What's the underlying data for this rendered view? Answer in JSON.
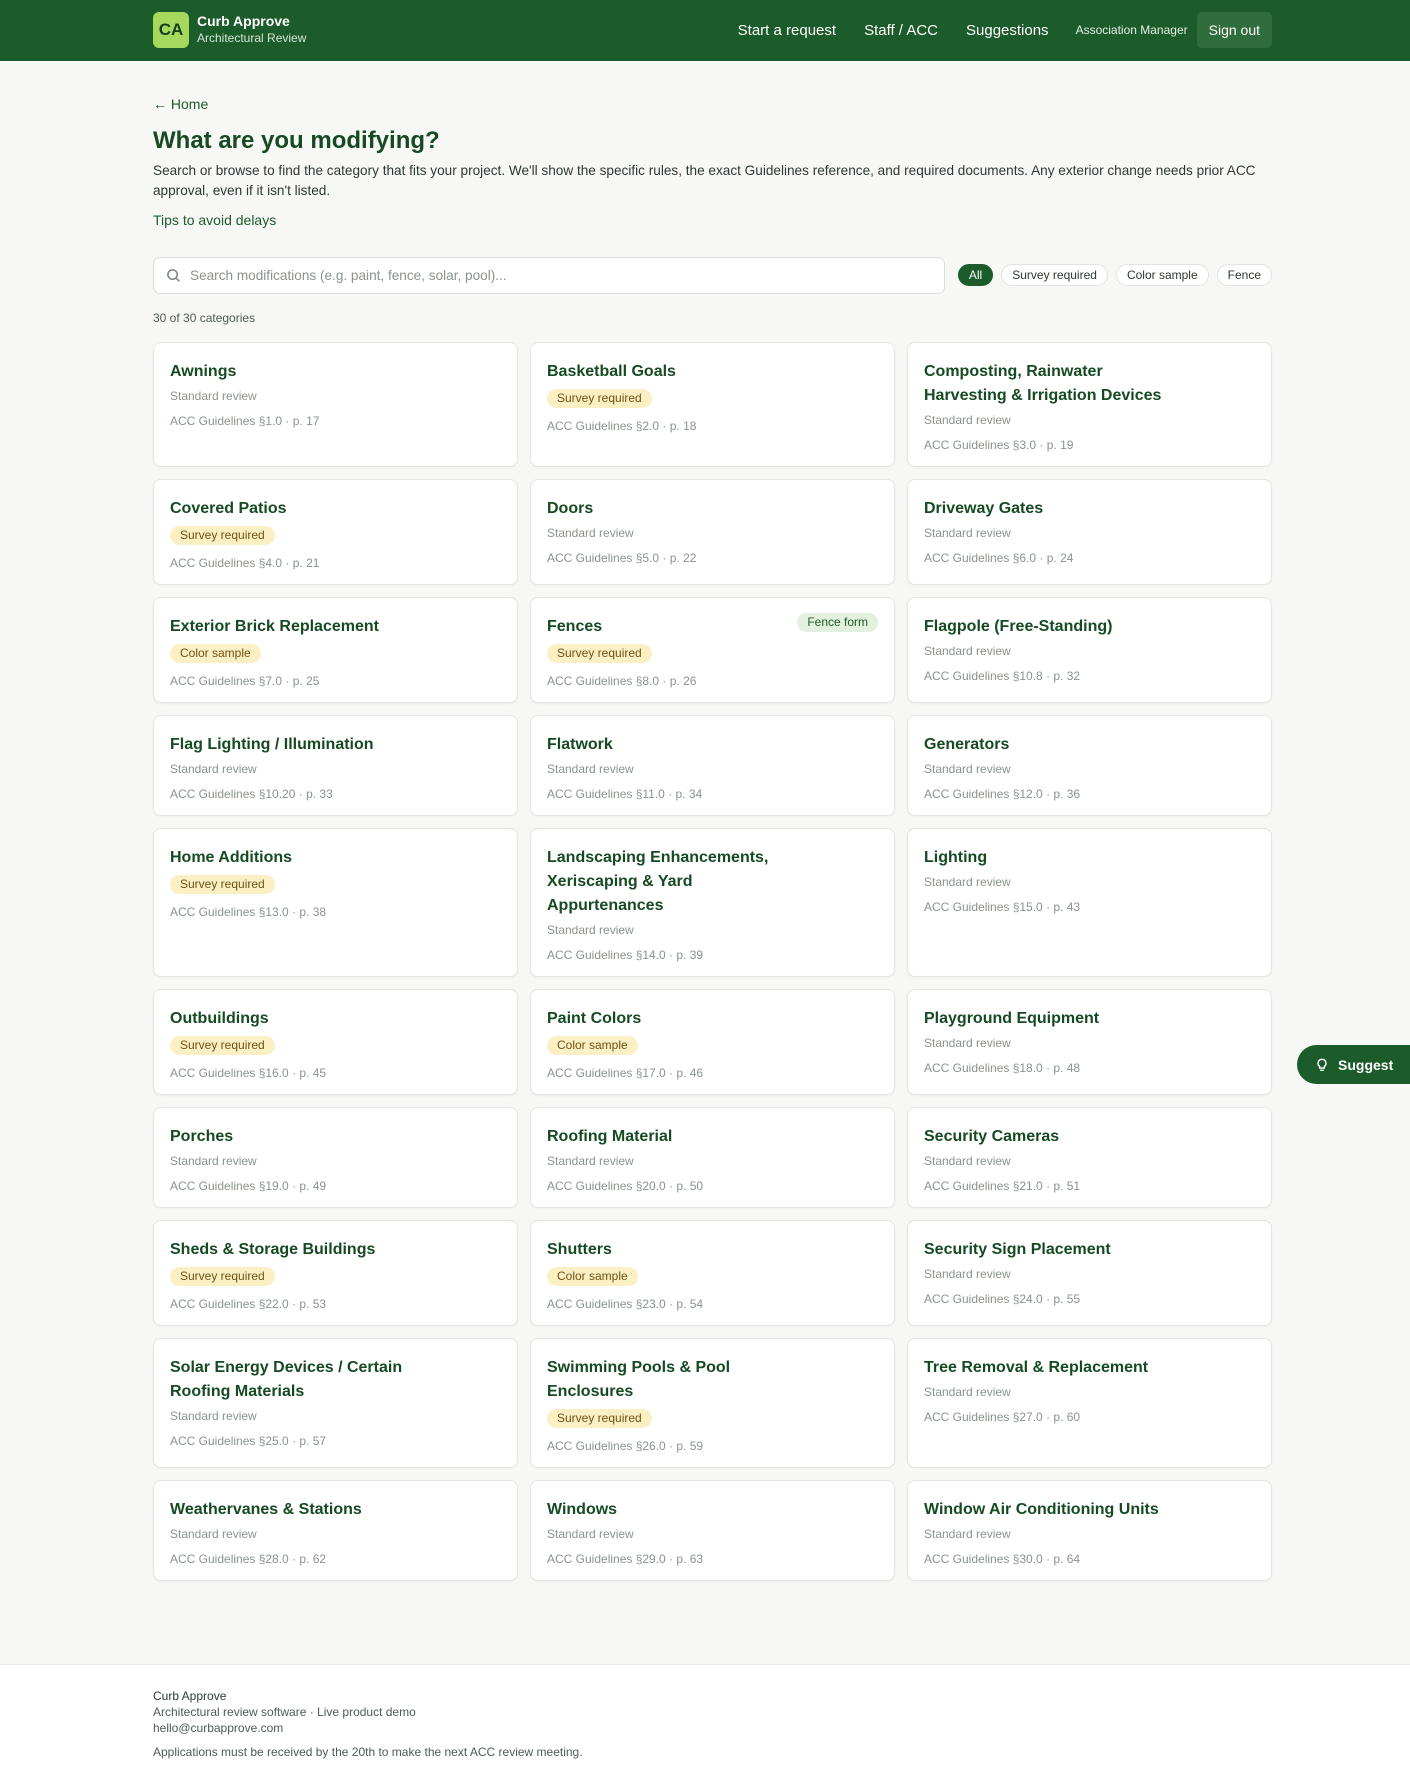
{
  "header": {
    "logo_text": "CA",
    "app_name": "Curb Approve",
    "app_subtitle": "Architectural Review",
    "nav": [
      {
        "label": "Start a request"
      },
      {
        "label": "Staff / ACC"
      },
      {
        "label": "Suggestions"
      }
    ],
    "role": "Association Manager",
    "sign_out": "Sign out",
    "brand_color": "#1c5b2a"
  },
  "page": {
    "back_link": "← Home",
    "title": "What are you modifying?",
    "intro": "Search or browse to find the category that fits your project. We'll show the specific rules, the exact Guidelines reference, and required documents. Any exterior change needs prior ACC approval, even if it isn't listed.",
    "tips_link": "Tips to avoid delays"
  },
  "search": {
    "placeholder": "Search modifications (e.g. paint, fence, solar, pool)...",
    "value": "",
    "icon": "search-icon"
  },
  "filters": [
    {
      "label": "All",
      "active": true
    },
    {
      "label": "Survey required",
      "active": false
    },
    {
      "label": "Color sample",
      "active": false
    },
    {
      "label": "Fence",
      "active": false
    }
  ],
  "count_text": "30 of 30 categories",
  "categories": [
    {
      "name": "Awnings",
      "badge": "",
      "review": "Standard review",
      "ref": "ACC Guidelines §1.0 · p. 17"
    },
    {
      "name": "Basketball Goals",
      "badge": "Survey required",
      "review": "",
      "ref": "ACC Guidelines §2.0 · p. 18"
    },
    {
      "name": "Composting, Rainwater Harvesting & Irrigation Devices",
      "badge": "",
      "review": "Standard review",
      "ref": "ACC Guidelines §3.0 · p. 19"
    },
    {
      "name": "Covered Patios",
      "badge": "Survey required",
      "review": "",
      "ref": "ACC Guidelines §4.0 · p. 21"
    },
    {
      "name": "Doors",
      "badge": "",
      "review": "Standard review",
      "ref": "ACC Guidelines §5.0 · p. 22"
    },
    {
      "name": "Driveway Gates",
      "badge": "",
      "review": "Standard review",
      "ref": "ACC Guidelines §6.0 · p. 24"
    },
    {
      "name": "Exterior Brick Replacement",
      "badge": "Color sample",
      "review": "",
      "ref": "ACC Guidelines §7.0 · p. 25"
    },
    {
      "name": "Fences",
      "badge": "Survey required",
      "review": "",
      "ref": "ACC Guidelines §8.0 · p. 26",
      "tag": "Fence form"
    },
    {
      "name": "Flagpole (Free-Standing)",
      "badge": "",
      "review": "Standard review",
      "ref": "ACC Guidelines §10.8 · p. 32"
    },
    {
      "name": "Flag Lighting / Illumination",
      "badge": "",
      "review": "Standard review",
      "ref": "ACC Guidelines §10.20 · p. 33"
    },
    {
      "name": "Flatwork",
      "badge": "",
      "review": "Standard review",
      "ref": "ACC Guidelines §11.0 · p. 34"
    },
    {
      "name": "Generators",
      "badge": "",
      "review": "Standard review",
      "ref": "ACC Guidelines §12.0 · p. 36"
    },
    {
      "name": "Home Additions",
      "badge": "Survey required",
      "review": "",
      "ref": "ACC Guidelines §13.0 · p. 38"
    },
    {
      "name": "Landscaping Enhancements, Xeriscaping & Yard Appurtenances",
      "badge": "",
      "review": "Standard review",
      "ref": "ACC Guidelines §14.0 · p. 39"
    },
    {
      "name": "Lighting",
      "badge": "",
      "review": "Standard review",
      "ref": "ACC Guidelines §15.0 · p. 43"
    },
    {
      "name": "Outbuildings",
      "badge": "Survey required",
      "review": "",
      "ref": "ACC Guidelines §16.0 · p. 45"
    },
    {
      "name": "Paint Colors",
      "badge": "Color sample",
      "review": "",
      "ref": "ACC Guidelines §17.0 · p. 46"
    },
    {
      "name": "Playground Equipment",
      "badge": "",
      "review": "Standard review",
      "ref": "ACC Guidelines §18.0 · p. 48"
    },
    {
      "name": "Porches",
      "badge": "",
      "review": "Standard review",
      "ref": "ACC Guidelines §19.0 · p. 49"
    },
    {
      "name": "Roofing Material",
      "badge": "",
      "review": "Standard review",
      "ref": "ACC Guidelines §20.0 · p. 50"
    },
    {
      "name": "Security Cameras",
      "badge": "",
      "review": "Standard review",
      "ref": "ACC Guidelines §21.0 · p. 51"
    },
    {
      "name": "Sheds & Storage Buildings",
      "badge": "Survey required",
      "review": "",
      "ref": "ACC Guidelines §22.0 · p. 53"
    },
    {
      "name": "Shutters",
      "badge": "Color sample",
      "review": "",
      "ref": "ACC Guidelines §23.0 · p. 54"
    },
    {
      "name": "Security Sign Placement",
      "badge": "",
      "review": "Standard review",
      "ref": "ACC Guidelines §24.0 · p. 55"
    },
    {
      "name": "Solar Energy Devices / Certain Roofing Materials",
      "badge": "",
      "review": "Standard review",
      "ref": "ACC Guidelines §25.0 · p. 57"
    },
    {
      "name": "Swimming Pools & Pool Enclosures",
      "badge": "Survey required",
      "review": "",
      "ref": "ACC Guidelines §26.0 · p. 59"
    },
    {
      "name": "Tree Removal & Replacement",
      "badge": "",
      "review": "Standard review",
      "ref": "ACC Guidelines §27.0 · p. 60"
    },
    {
      "name": "Weathervanes & Stations",
      "badge": "",
      "review": "Standard review",
      "ref": "ACC Guidelines §28.0 · p. 62"
    },
    {
      "name": "Windows",
      "badge": "",
      "review": "Standard review",
      "ref": "ACC Guidelines §29.0 · p. 63"
    },
    {
      "name": "Window Air Conditioning Units",
      "badge": "",
      "review": "Standard review",
      "ref": "ACC Guidelines §30.0 · p. 64"
    }
  ],
  "suggest_button": {
    "label": "Suggest",
    "icon": "lightbulb-icon"
  },
  "footer": {
    "name": "Curb Approve",
    "subtitle": "Architectural review software · Live product demo",
    "email": "hello@curbapprove.com",
    "note": "Applications must be received by the 20th to make the next ACC review meeting."
  }
}
